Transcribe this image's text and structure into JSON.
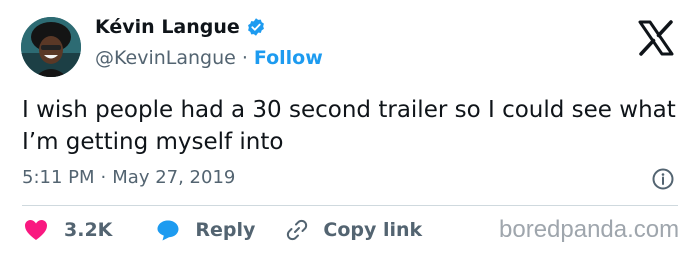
{
  "author": {
    "display_name": "Kévin Langue",
    "handle": "@KevinLangue",
    "separator": "·",
    "follow_label": "Follow",
    "verified": true
  },
  "tweet": {
    "text": "I wish people had a 30 second trailer so I could see what I’m getting myself into",
    "time": "5:11 PM",
    "separator": "·",
    "date": "May 27, 2019"
  },
  "actions": {
    "like_count": "3.2K",
    "reply_label": "Reply",
    "copy_link_label": "Copy link"
  },
  "watermark": "boredpanda.com",
  "icons": {
    "verified": "verified-badge-icon",
    "x_logo": "x-logo-icon",
    "info": "info-icon",
    "like": "heart-icon",
    "reply": "speech-bubble-icon",
    "copy": "link-icon"
  },
  "colors": {
    "accent": "#1d9bf0",
    "like": "#f91880",
    "text": "#0f1419",
    "secondary_text": "#536471",
    "divider": "#cfd9de"
  }
}
